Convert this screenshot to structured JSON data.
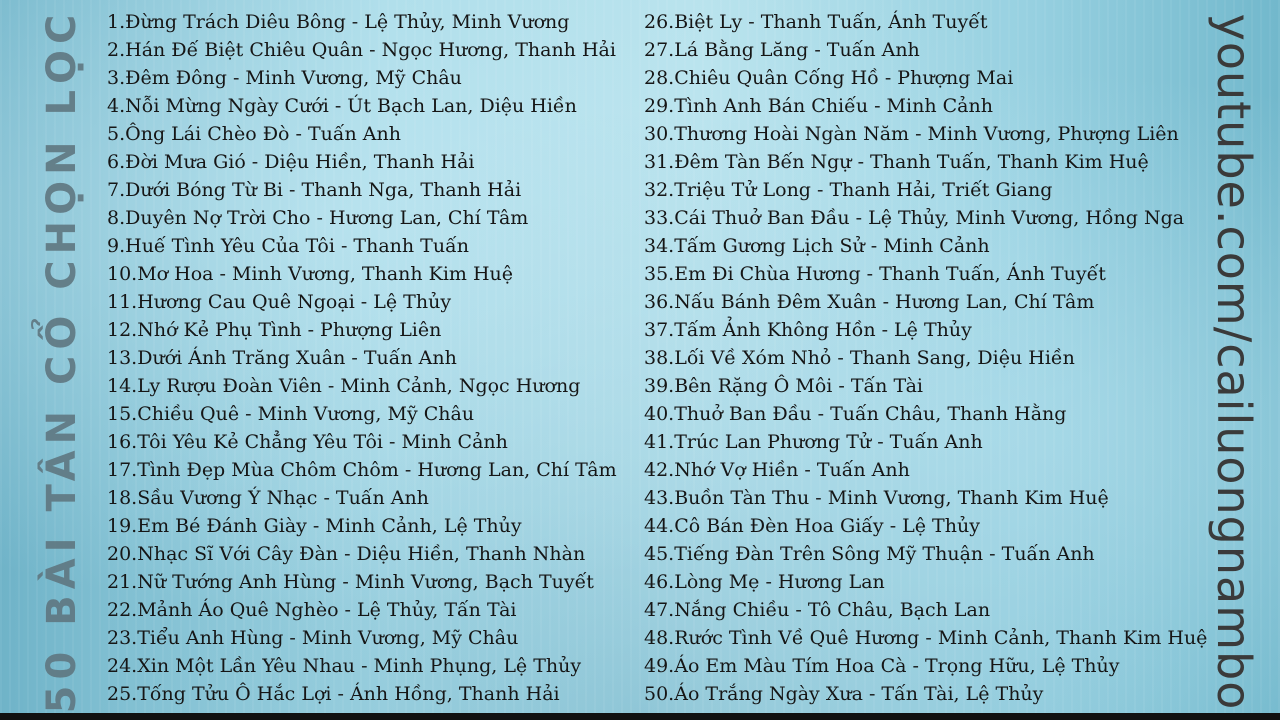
{
  "side_title": "50 BÀI TÂN CỔ CHỌN LỌC",
  "channel_url": "youtube.com/cailuongnambo",
  "songs_left": [
    "1.Đừng Trách Diêu Bông  - Lệ Thủy, Minh Vương",
    "2.Hán Đế Biệt Chiêu Quân  - Ngọc Hương, Thanh Hải",
    "3.Đêm Đông  - Minh Vương, Mỹ Châu",
    "4.Nỗi Mừng Ngày Cưới  - Út Bạch Lan, Diệu Hiền",
    "5.Ông Lái Chèo Đò  - Tuấn Anh",
    "6.Đời Mưa Gió  - Diệu Hiền, Thanh Hải",
    "7.Dưới Bóng Từ Bi  - Thanh Nga, Thanh Hải",
    "8.Duyên Nợ Trời Cho  - Hương Lan, Chí Tâm",
    "9.Huế Tình Yêu Của Tôi  - Thanh Tuấn",
    "10.Mơ Hoa  - Minh Vương, Thanh Kim Huệ",
    "11.Hương Cau Quê Ngoại  - Lệ Thủy",
    "12.Nhớ Kẻ Phụ Tình  - Phượng Liên",
    "13.Dưới Ánh Trăng Xuân  - Tuấn Anh",
    "14.Ly Rượu Đoàn Viên  - Minh Cảnh, Ngọc Hương",
    "15.Chiều Quê  - Minh Vương, Mỹ Châu",
    "16.Tôi Yêu Kẻ Chẳng Yêu Tôi  - Minh Cảnh",
    "17.Tình Đẹp Mùa Chôm Chôm  - Hương Lan, Chí Tâm",
    "18.Sầu Vương Ý Nhạc  - Tuấn Anh",
    "19.Em Bé Đánh Giày  - Minh Cảnh, Lệ Thủy",
    "20.Nhạc Sĩ Với Cây Đàn  - Diệu Hiền, Thanh Nhàn",
    "21.Nữ Tướng Anh Hùng  - Minh Vương, Bạch Tuyết",
    "22.Mảnh Áo Quê Nghèo  - Lệ Thủy, Tấn Tài",
    "23.Tiểu Anh Hùng  - Minh Vương, Mỹ Châu",
    "24.Xin Một Lần Yêu Nhau  - Minh Phụng, Lệ Thủy",
    "25.Tống Tửu Ô Hắc Lợi  - Ánh Hồng, Thanh Hải"
  ],
  "songs_right": [
    "26.Biệt Ly  - Thanh Tuấn, Ánh Tuyết",
    "27.Lá Bằng Lăng  - Tuấn Anh",
    "28.Chiêu Quân Cống Hồ  - Phượng Mai",
    "29.Tình Anh Bán Chiếu  - Minh Cảnh",
    "30.Thương Hoài Ngàn Năm  - Minh Vương, Phượng Liên",
    "31.Đêm Tàn Bến Ngự  - Thanh Tuấn, Thanh Kim Huệ",
    "32.Triệu Tử Long  - Thanh Hải, Triết Giang",
    "33.Cái Thuở Ban Đầu  - Lệ Thủy, Minh Vương, Hồng Nga",
    "34.Tấm Gương Lịch Sử  - Minh Cảnh",
    "35.Em Đi Chùa Hương  - Thanh Tuấn, Ánh Tuyết",
    "36.Nấu Bánh Đêm Xuân  - Hương Lan, Chí Tâm",
    "37.Tấm Ảnh Không Hồn  - Lệ Thủy",
    "38.Lối Về Xóm Nhỏ  - Thanh Sang, Diệu Hiền",
    "39.Bên Rặng Ô Môi  - Tấn Tài",
    "40.Thuở Ban Đầu  - Tuấn Châu, Thanh Hằng",
    "41.Trúc Lan Phương Tử  - Tuấn Anh",
    "42.Nhớ Vợ Hiền  - Tuấn Anh",
    "43.Buồn Tàn Thu  - Minh Vương, Thanh Kim Huệ",
    "44.Cô Bán Đèn Hoa Giấy  - Lệ Thủy",
    "45.Tiếng Đàn Trên Sông Mỹ Thuận  - Tuấn Anh",
    "46.Lòng Mẹ  - Hương Lan",
    "47.Nắng Chiều  - Tô Châu, Bạch Lan",
    "48.Rước Tình Về Quê Hương  - Minh Cảnh, Thanh Kim Huệ",
    "49.Áo Em Màu Tím Hoa Cà  - Trọng Hữu, Lệ Thủy",
    "50.Áo Trắng Ngày Xưa  - Tấn Tài, Lệ Thủy"
  ]
}
